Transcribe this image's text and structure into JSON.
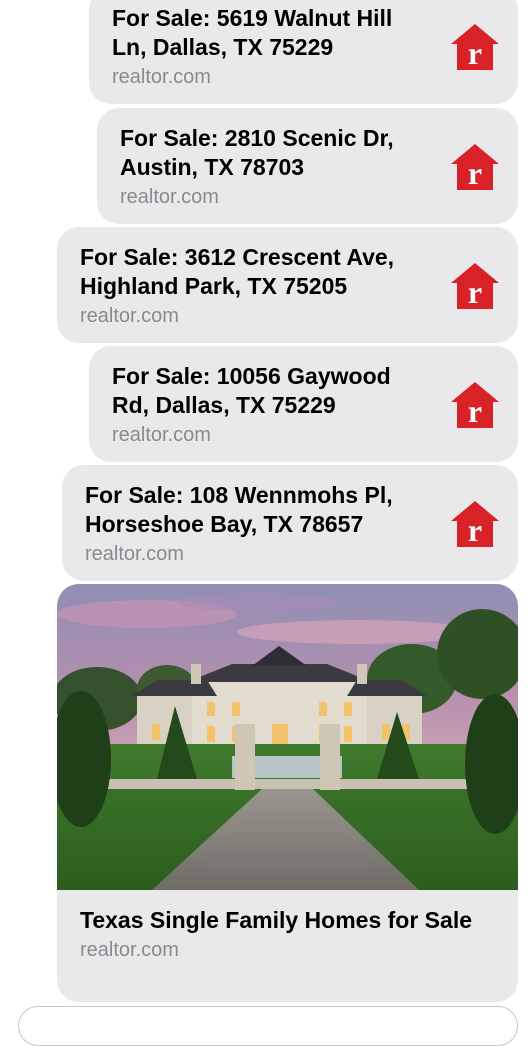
{
  "messages": [
    {
      "title": "For Sale: 5619 Walnut Hill Ln, Dallas, TX 75229",
      "domain": "realtor.com",
      "icon": "realtor-r-icon"
    },
    {
      "title": "For Sale: 2810 Scenic Dr, Austin, TX 78703",
      "domain": "realtor.com",
      "icon": "realtor-r-icon"
    },
    {
      "title": "For Sale: 3612 Crescent Ave, Highland Park, TX 75205",
      "domain": "realtor.com",
      "icon": "realtor-r-icon"
    },
    {
      "title": "For Sale: 10056 Gaywood Rd, Dallas, TX 75229",
      "domain": "realtor.com",
      "icon": "realtor-r-icon"
    },
    {
      "title": "For Sale: 108 Wennmohs Pl, Horseshoe Bay, TX 78657",
      "domain": "realtor.com",
      "icon": "realtor-r-icon"
    }
  ],
  "rich_link": {
    "title": "Texas Single Family Homes for Sale",
    "domain": "realtor.com",
    "image": "mansion-photo"
  },
  "colors": {
    "bubble": "#e9e9eb",
    "brand_red": "#d92228",
    "domain_text": "#8a8a8e"
  }
}
